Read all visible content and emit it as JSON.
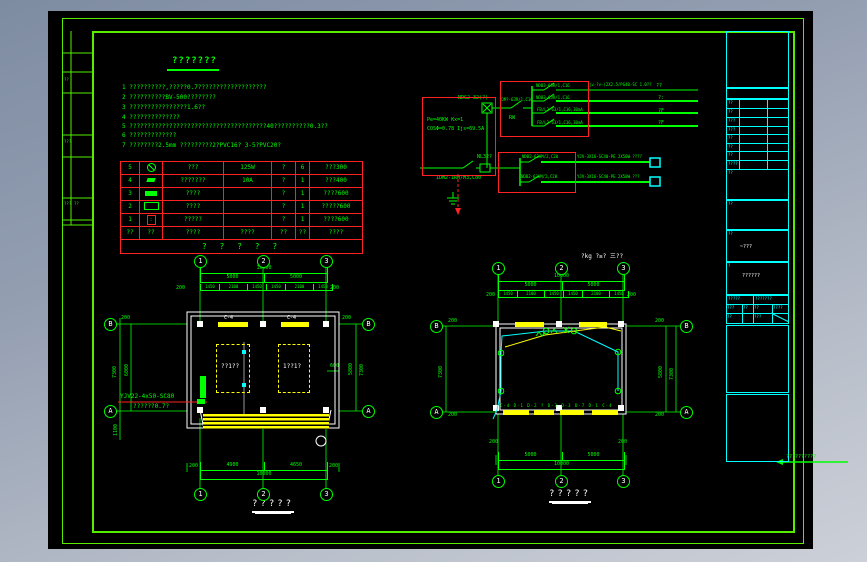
{
  "notes": {
    "title": "???????",
    "lines": [
      "1 ??????????,?????0.7???????????????????",
      "2 ??????????BV-500????????",
      "3 ????????????????1.6??",
      "4 ??????????????",
      "5 ??????????????????????????????????????40??????????0.3??",
      "6 ?????????????",
      "7 ????????2.5mm ?????????2?PVC16?  3-5?PVC20?"
    ]
  },
  "left_strip": {
    "c1": "??",
    "c2": "???",
    "c3": "???",
    "c4": "??"
  },
  "equip_table": {
    "rows": [
      {
        "no": "5",
        "sym": "",
        "name": "???",
        "spec": "125W",
        "unit": "?",
        "qty": "6",
        "note": "???300"
      },
      {
        "no": "4",
        "sym": "",
        "name": "???????",
        "spec": "10A",
        "unit": "?",
        "qty": "1",
        "note": "???400"
      },
      {
        "no": "3",
        "sym": "",
        "name": "????",
        "spec": "",
        "unit": "?",
        "qty": "1",
        "note": "????600"
      },
      {
        "no": "2",
        "sym": "",
        "name": "????",
        "spec": "",
        "unit": "?",
        "qty": "1",
        "note": "?????600"
      },
      {
        "no": "1",
        "sym": "",
        "name": "?????",
        "spec": "",
        "unit": "?",
        "qty": "1",
        "note": "????600"
      },
      {
        "no": "??",
        "sym": "??",
        "name": "????",
        "spec": "????",
        "unit": "??",
        "qty": "??",
        "note": "????"
      }
    ],
    "footer": "? ? ? ? ?"
  },
  "circuit": {
    "incoming_label": "NDG2-32(?)",
    "stats1": "Pe=40KW Kx=1",
    "stats2": "COSΦ=0.78 Ijs=69.5A",
    "main_switch": "1DM2-1RM/M3,C80",
    "nl_label": "NL32?",
    "panel_main": "?DM?-63R/1,C16",
    "panel_tag": "RW",
    "branches": [
      {
        "breaker": "NDB3-63R/1,C16",
        "cable": "jv-?v-(2X2.5/PG40-SC 1.0??",
        "dest": "??"
      },
      {
        "breaker": "NDB3-63R/1,C16",
        "cable": "",
        "dest": "?:"
      },
      {
        "breaker": "FB/L3-63/1,C16,30mA",
        "cable": "",
        "dest": "?F"
      },
      {
        "breaker": "FB/L3-63/1,C16,30mA",
        "cable": "",
        "dest": "?F"
      }
    ],
    "sub_branches": [
      {
        "breaker": "NDB2-63HM/2,C20",
        "cable": "YJV-3X16-SC40-PE 2X50W ????"
      },
      {
        "breaker": "NDB2-63HM/2,C20",
        "cable": "YJV-3X16-SC40-PE 2X50W ???"
      }
    ]
  },
  "plan_left": {
    "grid_top": [
      "1",
      "2",
      "3"
    ],
    "grid_bottom": [
      "1",
      "2",
      "3"
    ],
    "grid_side_left": [
      "B",
      "A"
    ],
    "grid_side_right": [
      "B",
      "A"
    ],
    "dim_total": "10000",
    "dim_mid": [
      "5000",
      "5000"
    ],
    "dim_detail": [
      "1450",
      "2100",
      "1450",
      "1450",
      "2100",
      "1450"
    ],
    "dim_end_left": "200",
    "dim_end_right": "200",
    "left_dims": {
      "d200": "200",
      "d7300": "7300",
      "d6000": "6000",
      "d1100": "1100"
    },
    "right_dims": {
      "d200": "200",
      "d5800": "5800",
      "d7300": "7300",
      "d600": "600"
    },
    "window_labels": [
      "C-4",
      "C-4"
    ],
    "room_labels": [
      "??1??",
      "1??1?"
    ],
    "cable1": "YJV22-4x50-SC80",
    "cable2": "??????0.7?",
    "bottom_dims": [
      "4900",
      "4650"
    ],
    "bottom_total": "10000",
    "bottom_end_left": "200",
    "bottom_end_right": "200",
    "title": "?????"
  },
  "plan_right": {
    "grid_top": [
      "1",
      "2",
      "3"
    ],
    "grid_bottom": [
      "1",
      "2",
      "3"
    ],
    "grid_side_left": [
      "B",
      "A"
    ],
    "grid_side_right": [
      "B",
      "A"
    ],
    "header_note": "?kg ?≥? 三??",
    "dim_total": "10000",
    "dim_mid": [
      "5000",
      "5000"
    ],
    "dim_detail": [
      "1450",
      "2100",
      "1450",
      "1450",
      "2100",
      "1450"
    ],
    "dim_end_left": "200",
    "dim_end_right": "200",
    "left_dims": {
      "d200a": "200",
      "d7300": "7300",
      "d200b": "200"
    },
    "right_dims": {
      "d200a": "200",
      "d5800": "5800",
      "d7300": "7300",
      "d200b": "200"
    },
    "fixtures": "C-4  D-1  D-2  ?  D-3  D-3  D-7  D-1  C-4",
    "bottom_dims": [
      "5000",
      "5000"
    ],
    "bottom_total": "10000",
    "bottom_end_left": "200",
    "bottom_end_right": "200",
    "title": "?????"
  },
  "titleblock": {
    "row_labels": [
      "??",
      "??",
      "???",
      "???",
      "??",
      "??",
      "??",
      "????"
    ],
    "sec_labels": [
      "??",
      "??",
      "??",
      "?"
    ],
    "sec3_text": "~???",
    "sec4_text": "??????",
    "bt_r1": [
      "?????",
      "???????"
    ],
    "bt_r2": [
      "???",
      "??",
      "??",
      "????"
    ],
    "bt_r3": [
      "??",
      "???"
    ],
    "overflow_note": "??????????"
  }
}
